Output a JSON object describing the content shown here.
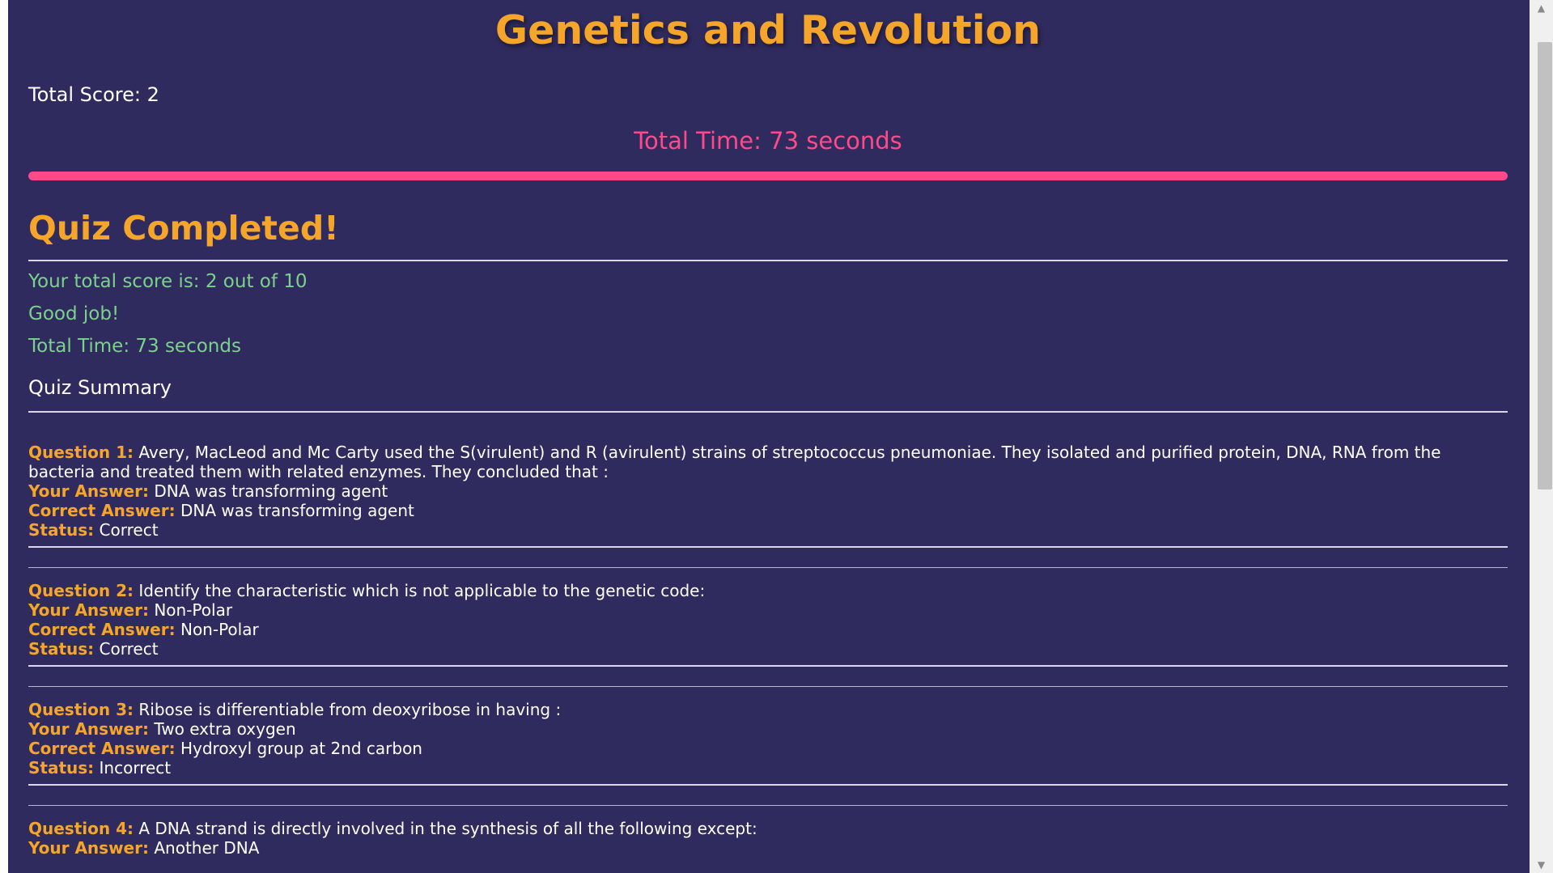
{
  "app_title": "Genetics and Revolution",
  "header": {
    "total_score": "Total Score: 2",
    "total_time": "Total Time: 73 seconds"
  },
  "progress": {
    "fraction": 1.0,
    "color": "#ff4a8a"
  },
  "results": {
    "title": "Quiz Completed!",
    "score_line": "Your total score is: 2 out of 10",
    "feedback": "Good job!",
    "time_line": "Total Time: 73 seconds",
    "summary_heading": "Quiz Summary"
  },
  "labels": {
    "question_prefix": "Question",
    "your_answer": "Your Answer:",
    "correct_answer": "Correct Answer:",
    "status": "Status:"
  },
  "questions": [
    {
      "number": "1",
      "text": "Avery, MacLeod and Mc Carty used the S(virulent) and R (avirulent) strains of streptococcus pneumoniae. They isolated and purified protein, DNA, RNA from the bacteria and treated them with related enzymes. They concluded that :",
      "your_answer": "DNA was transforming agent",
      "correct_answer": "DNA was transforming agent",
      "status": "Correct"
    },
    {
      "number": "2",
      "text": "Identify the characteristic which is not applicable to the genetic code:",
      "your_answer": "Non-Polar",
      "correct_answer": "Non-Polar",
      "status": "Correct"
    },
    {
      "number": "3",
      "text": "Ribose is differentiable from deoxyribose in having :",
      "your_answer": "Two extra oxygen",
      "correct_answer": "Hydroxyl group at 2nd carbon",
      "status": "Incorrect"
    },
    {
      "number": "4",
      "text": "A DNA strand is directly involved in the synthesis of all the following except:",
      "your_answer": "Another DNA"
    }
  ],
  "colors": {
    "background": "#2f2b5e",
    "accent_orange": "#f6a52b",
    "accent_pink": "#ff4a8a",
    "result_green": "#7bd389",
    "text_white": "#ffffff"
  },
  "icons": {
    "scroll_up": "chevron-up-icon",
    "scroll_down": "chevron-down-icon"
  }
}
